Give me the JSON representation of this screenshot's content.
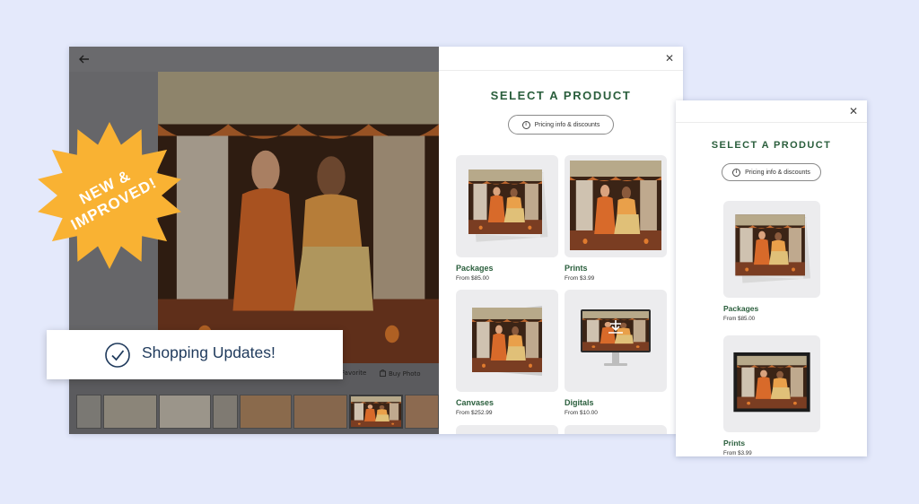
{
  "viewer": {
    "back_icon": "arrow-left-icon",
    "actions": [
      {
        "icon": "heart-icon",
        "label": "Favorite"
      },
      {
        "icon": "bag-icon",
        "label": "Buy Photo"
      }
    ]
  },
  "panel": {
    "title": "SELECT A PRODUCT",
    "pricing_label": "Pricing info & discounts",
    "products": [
      {
        "name": "Packages",
        "price": "From $85.00"
      },
      {
        "name": "Prints",
        "price": "From $3.99"
      },
      {
        "name": "Canvases",
        "price": "From $252.99"
      },
      {
        "name": "Digitals",
        "price": "From $10.00"
      }
    ]
  },
  "mobile": {
    "title": "SELECT A PRODUCT",
    "pricing_label": "Pricing info & discounts",
    "products": [
      {
        "name": "Packages",
        "price": "From $85.00"
      },
      {
        "name": "Prints",
        "price": "From $3.99"
      }
    ]
  },
  "badge": {
    "line1": "NEW &",
    "line2": "IMPROVED!",
    "color": "#f9b233"
  },
  "banner": {
    "text": "Shopping Updates!",
    "icon": "check-circle-icon",
    "color": "#1f3a5c"
  },
  "colors": {
    "accent": "#2a5e3c",
    "background": "#e4e9fb"
  }
}
